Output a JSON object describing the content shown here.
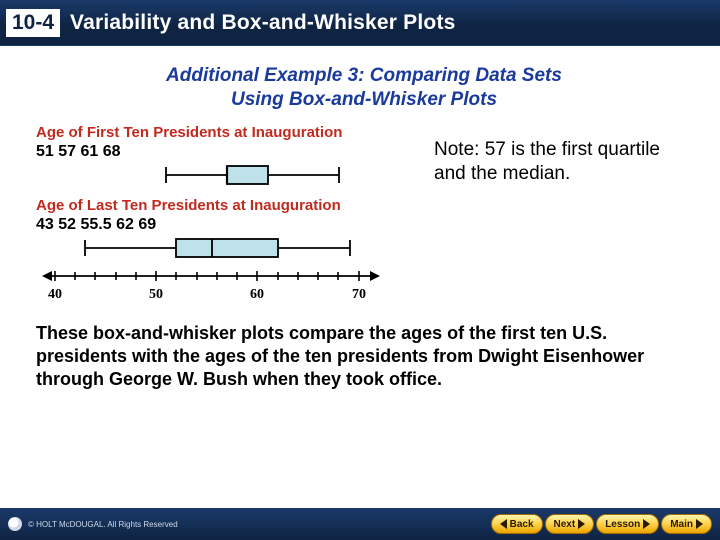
{
  "header": {
    "section": "10-4",
    "title": "Variability and Box-and-Whisker Plots"
  },
  "subtitle_line1": "Additional Example 3: Comparing Data Sets",
  "subtitle_line2": "Using Box-and-Whisker Plots",
  "note": "Note: 57 is the first quartile and the median.",
  "body": "These box-and-whisker plots compare the ages of the first ten U.S. presidents with the ages of the ten presidents from Dwight Eisenhower through George W. Bush when they took office.",
  "chart_data": [
    {
      "type": "boxplot",
      "title": "Age of First Ten Presidents at Inauguration",
      "min": 51,
      "q1": 57,
      "median": 57,
      "q3": 61,
      "max": 68,
      "labels": [
        "51",
        "57",
        "61",
        "68"
      ],
      "axis": {
        "min": 40,
        "max": 70,
        "ticks": [
          40,
          42,
          44,
          46,
          48,
          50,
          52,
          54,
          56,
          58,
          60,
          62,
          64,
          66,
          68,
          70
        ],
        "major": [
          40,
          50,
          60,
          70
        ]
      }
    },
    {
      "type": "boxplot",
      "title": "Age of Last Ten Presidents at Inauguration",
      "min": 43,
      "q1": 52,
      "median": 55.5,
      "q3": 62,
      "max": 69,
      "labels": [
        "43",
        "52",
        "55.5",
        "62",
        "69"
      ],
      "axis": {
        "min": 40,
        "max": 70,
        "ticks": [
          40,
          42,
          44,
          46,
          48,
          50,
          52,
          54,
          56,
          58,
          60,
          62,
          64,
          66,
          68,
          70
        ],
        "major": [
          40,
          50,
          60,
          70
        ]
      }
    }
  ],
  "axis_labels": {
    "t40": "40",
    "t50": "50",
    "t60": "60",
    "t70": "70"
  },
  "footer": {
    "copyright": "© HOLT McDOUGAL. All Rights Reserved",
    "back": "Back",
    "next": "Next",
    "lesson": "Lesson",
    "main": "Main"
  }
}
